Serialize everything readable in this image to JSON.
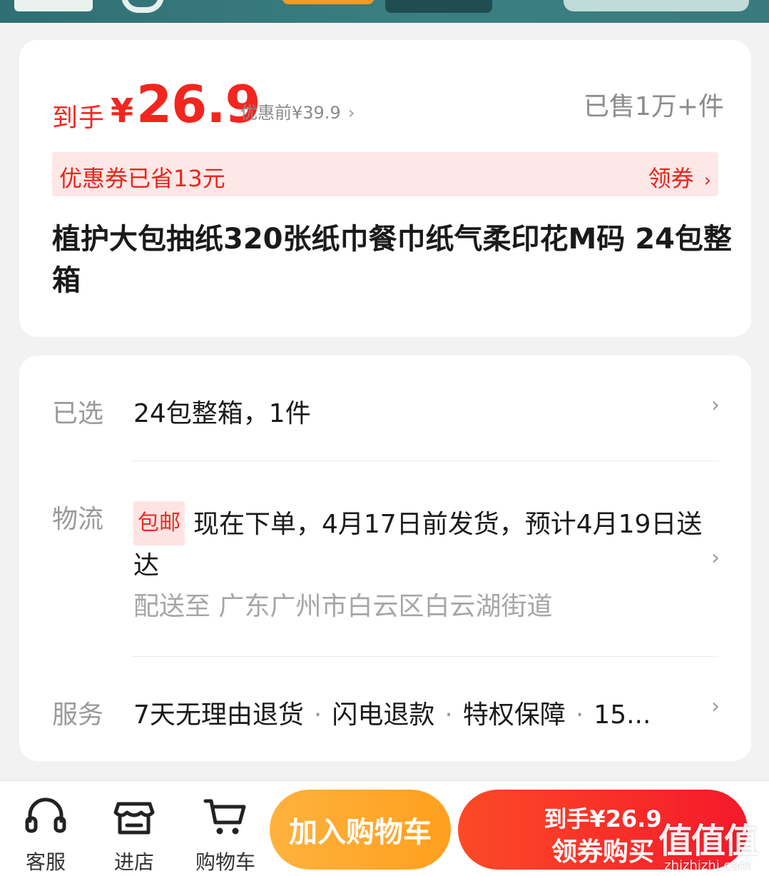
{
  "price_card": {
    "prefix": "到手",
    "yen": "¥",
    "price": "26.9",
    "original": "优惠前¥39.9",
    "sold": "已售1万+件",
    "coupon_text": "优惠券已省13元",
    "coupon_link": "领券",
    "title": "植护大包抽纸320张纸巾餐巾纸气柔印花M码 24包整箱"
  },
  "detail_card": {
    "selected_label": "已选",
    "selected_value": "24包整箱，1件",
    "shipping_label": "物流",
    "shipping_tag": "包邮",
    "shipping_text": "现在下单，4月17日前发货，预计4月19日送达",
    "shipping_address": "配送至 广东广州市白云区白云湖街道",
    "service_label": "服务",
    "services": [
      "7天无理由退货",
      "闪电退款",
      "特权保障",
      "15..."
    ]
  },
  "bottom_bar": {
    "service_label": "客服",
    "store_label": "进店",
    "cart_label": "购物车",
    "add_to_cart": "加入购物车",
    "buy_line1": "到手¥26.9",
    "buy_line2": "领券购买"
  },
  "watermark": {
    "logo_text": "值值值",
    "site": "zhizhizhi.com"
  },
  "colors": {
    "accent_red": "#f2261f",
    "coupon_bg": "#fde8e7",
    "add_btn_orange": "#ffa62a",
    "buy_btn_red": "#f7262a"
  }
}
